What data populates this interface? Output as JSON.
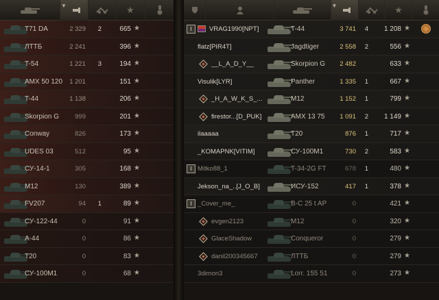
{
  "left_header": {
    "tank_icon": "tank-icon",
    "sort_icon": "sort-arrow-icon",
    "damage_icon": "damage-icon",
    "kills_icon": "kills-icon",
    "xp_icon": "star-icon",
    "medal_icon": "medal-icon"
  },
  "right_header": {
    "squad_icon": "squad-icon",
    "player_icon": "player-icon",
    "tank_icon": "tank-icon",
    "sort_icon": "sort-arrow-icon",
    "damage_icon": "damage-icon",
    "kills_icon": "kills-icon",
    "xp_icon": "star-icon",
    "medal_icon": "medal-icon"
  },
  "left_rows": [
    {
      "vehicle": "T71 DA",
      "damage": "2 329",
      "kills": "2",
      "xp": "665"
    },
    {
      "vehicle": "ЛТТБ",
      "damage": "2 241",
      "kills": "",
      "xp": "396"
    },
    {
      "vehicle": "T-54",
      "damage": "1 221",
      "kills": "3",
      "xp": "194"
    },
    {
      "vehicle": "AMX 50 120",
      "damage": "1 201",
      "kills": "",
      "xp": "151"
    },
    {
      "vehicle": "T-44",
      "damage": "1 138",
      "kills": "",
      "xp": "206"
    },
    {
      "vehicle": "Skorpion G",
      "damage": "999",
      "kills": "",
      "xp": "201"
    },
    {
      "vehicle": "Conway",
      "damage": "826",
      "kills": "",
      "xp": "173"
    },
    {
      "vehicle": "UDES 03",
      "damage": "512",
      "kills": "",
      "xp": "95"
    },
    {
      "vehicle": "СУ-14-1",
      "damage": "305",
      "kills": "",
      "xp": "168"
    },
    {
      "vehicle": "M12",
      "damage": "130",
      "kills": "",
      "xp": "389"
    },
    {
      "vehicle": "FV207",
      "damage": "94",
      "kills": "1",
      "xp": "89"
    },
    {
      "vehicle": "СУ-122-44",
      "damage": "0",
      "kills": "",
      "xp": "91"
    },
    {
      "vehicle": "A-44",
      "damage": "0",
      "kills": "",
      "xp": "86"
    },
    {
      "vehicle": "T20",
      "damage": "0",
      "kills": "",
      "xp": "83"
    },
    {
      "vehicle": "СУ-100М1",
      "damage": "0",
      "kills": "",
      "xp": "68"
    }
  ],
  "right_rows": [
    {
      "player": "VRAG1990[NPT]",
      "vehicle": "T-44",
      "damage": "3 741",
      "kills": "4",
      "xp": "1 208",
      "badge": "rank",
      "flag": true,
      "medal": true
    },
    {
      "player": "flatz[PIR4T]",
      "vehicle": "Jagdtiger",
      "damage": "2 558",
      "kills": "2",
      "xp": "556",
      "badge": ""
    },
    {
      "player": "__L_A_D_Y__",
      "vehicle": "Skorpion G",
      "damage": "2 482",
      "kills": "",
      "xp": "633",
      "badge": "diamond"
    },
    {
      "player": "Visulik[LYR]",
      "vehicle": "Panther",
      "damage": "1 335",
      "kills": "1",
      "xp": "667",
      "badge": ""
    },
    {
      "player": "_H_A_W_K_S_...",
      "vehicle": "M12",
      "damage": "1 152",
      "kills": "1",
      "xp": "799",
      "badge": "diamond"
    },
    {
      "player": "firestor...[D_PUK]",
      "vehicle": "AMX 13 75",
      "damage": "1 091",
      "kills": "2",
      "xp": "1 149",
      "badge": "diamond"
    },
    {
      "player": "ilaaaaa",
      "vehicle": "T20",
      "damage": "876",
      "kills": "1",
      "xp": "717",
      "badge": ""
    },
    {
      "player": "_KOMAPNK[VITIM]",
      "vehicle": "СУ-100М1",
      "damage": "730",
      "kills": "2",
      "xp": "583",
      "badge": ""
    },
    {
      "player": "Mitko88_1",
      "vehicle": "T-34-2G FT",
      "damage": "678",
      "kills": "1",
      "xp": "480",
      "badge": "rank",
      "dead": true
    },
    {
      "player": "Jekson_na_..[J_O_B]",
      "vehicle": "ИСУ-152",
      "damage": "417",
      "kills": "1",
      "xp": "378",
      "badge": ""
    },
    {
      "player": "_Cover_me_",
      "vehicle": "B-C 25 t AP",
      "damage": "0",
      "kills": "",
      "xp": "421",
      "badge": "rank",
      "dead": true
    },
    {
      "player": "evgen2123",
      "vehicle": "M12",
      "damage": "0",
      "kills": "",
      "xp": "320",
      "badge": "diamond",
      "dead": true
    },
    {
      "player": "GlaceShadow",
      "vehicle": "Conqueror",
      "damage": "0",
      "kills": "",
      "xp": "279",
      "badge": "diamond",
      "dead": true
    },
    {
      "player": "danil200345667",
      "vehicle": "ЛТТБ",
      "damage": "0",
      "kills": "",
      "xp": "279",
      "badge": "diamond",
      "dead": true
    },
    {
      "player": "3dimon3",
      "vehicle": "Lorr. 155 51",
      "damage": "0",
      "kills": "",
      "xp": "273",
      "badge": "",
      "dead": true
    }
  ],
  "star_glyph": "★",
  "colors": {
    "damage_high": "#d9c27a",
    "damage_low": "#8a8376",
    "kills": "#d8d2c6"
  }
}
